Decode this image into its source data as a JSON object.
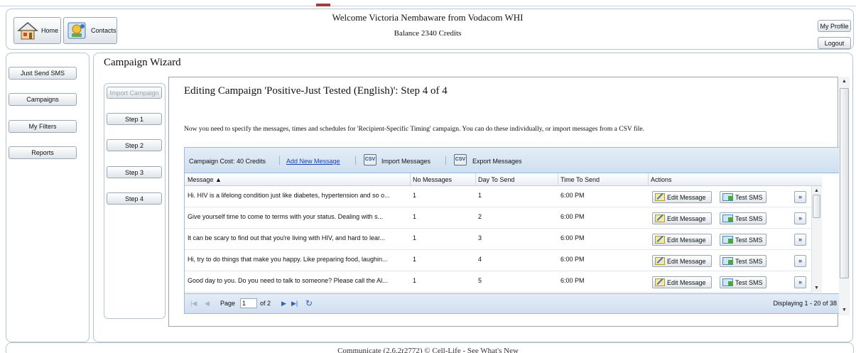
{
  "header": {
    "home_label": "Home",
    "contacts_label": "Contacts",
    "welcome_line": "Welcome Victoria Nembaware from Vodacom WHI",
    "balance_line": "Balance 2340 Credits",
    "my_profile_label": "My Profile",
    "logout_label": "Logout"
  },
  "nav": {
    "items": [
      {
        "label": "Just Send SMS"
      },
      {
        "label": "Campaigns"
      },
      {
        "label": "My Filters"
      },
      {
        "label": "Reports"
      }
    ]
  },
  "wizard": {
    "title": "Campaign Wizard",
    "import_campaign_label": "Import Campaign",
    "steps": [
      {
        "label": "Step 1"
      },
      {
        "label": "Step 2"
      },
      {
        "label": "Step 3"
      },
      {
        "label": "Step 4"
      }
    ],
    "editing_title": "Editing Campaign 'Positive-Just Tested (English)': Step 4 of 4",
    "instructions": "Now you need to specify the messages, times and schedules for 'Recipient-Specific Timing' campaign. You can do these individually, or import messages from a CSV file."
  },
  "grid": {
    "campaign_cost": "Campaign Cost: 40 Credits",
    "add_new_message": "Add New Message",
    "import_messages": "Import Messages",
    "export_messages": "Export Messages",
    "csv_icon": "csv-file-icon",
    "columns": [
      "Message ▲",
      "No Messages",
      "Day To Send",
      "Time To Send",
      "Actions"
    ],
    "rows": [
      {
        "message": "Hi. HIV is a lifelong condition just like diabetes, hypertension and so o...",
        "no_messages": "1",
        "day": "1",
        "time": "6:00 PM"
      },
      {
        "message": "Give yourself time to come to terms with your status. Dealing with s...",
        "no_messages": "1",
        "day": "2",
        "time": "6:00 PM"
      },
      {
        "message": "It can be scary to find out that you're living with HIV, and hard to lear...",
        "no_messages": "1",
        "day": "3",
        "time": "6:00 PM"
      },
      {
        "message": "Hi, try to do things that make you happy. Like preparing food, laughin...",
        "no_messages": "1",
        "day": "4",
        "time": "6:00 PM"
      },
      {
        "message": "Good day to you. Do you need to talk to someone? Please call the Al...",
        "no_messages": "1",
        "day": "5",
        "time": "6:00 PM"
      }
    ],
    "edit_message_label": "Edit Message",
    "test_sms_label": "Test SMS",
    "more_label": "»"
  },
  "pager": {
    "page_label": "Page",
    "page_value": "1",
    "of_label": "of 2",
    "displaying": "Displaying 1 - 20 of 38"
  },
  "footer": {
    "text": "Communicate (2.6.2r2772) © Cell-Life  -  See What's New"
  },
  "colors": {
    "grid_header_bg": "#cfdfef",
    "link": "#1a3fb4",
    "border": "#99bbe8"
  }
}
